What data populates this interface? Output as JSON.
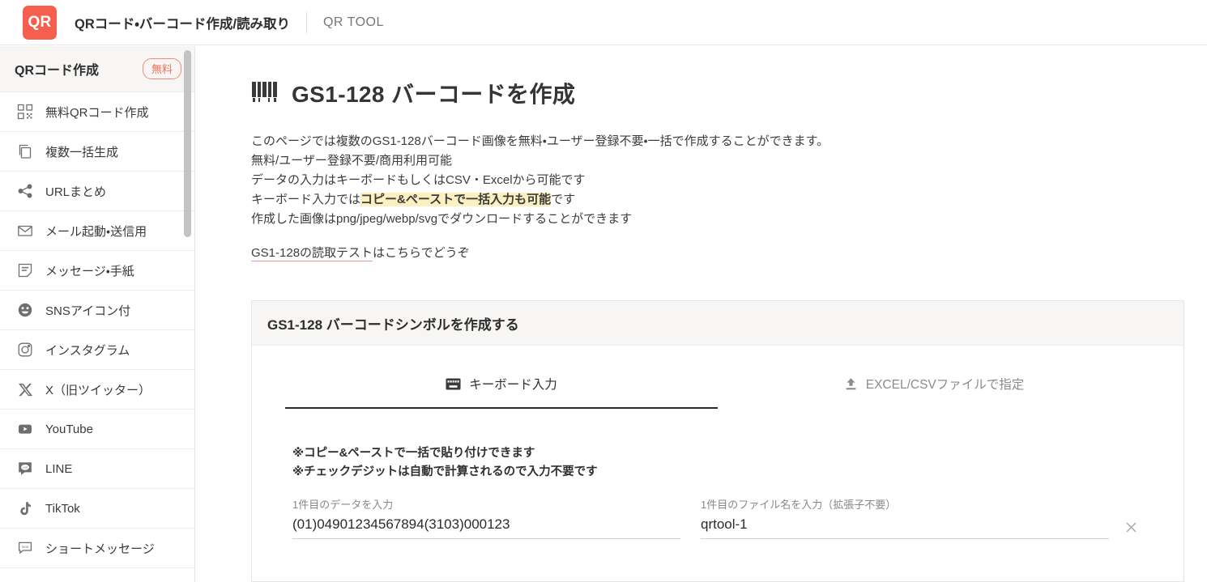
{
  "header": {
    "logo_text": "QR",
    "logo_color": "#f4604d",
    "title": "QRコード・バーコード作成/読み取り",
    "sub_title": "QR TOOL"
  },
  "sidebar": {
    "section_title": "QRコード作成",
    "badge": "無料",
    "badge_color": "#f0705c",
    "items": [
      {
        "label": "無料QRコード作成",
        "icon": "qr-grid-icon"
      },
      {
        "label": "複数一括生成",
        "icon": "copy-icon"
      },
      {
        "label": "URLまとめ",
        "icon": "share-icon"
      },
      {
        "label": "メール起動・送信用",
        "icon": "mail-icon"
      },
      {
        "label": "メッセージ・手紙",
        "icon": "note-icon"
      },
      {
        "label": "SNSアイコン付",
        "icon": "smiley-icon"
      },
      {
        "label": "インスタグラム",
        "icon": "instagram-icon"
      },
      {
        "label": "X（旧ツイッター）",
        "icon": "x-twitter-icon"
      },
      {
        "label": "YouTube",
        "icon": "youtube-icon"
      },
      {
        "label": "LINE",
        "icon": "line-icon"
      },
      {
        "label": "TikTok",
        "icon": "tiktok-icon"
      },
      {
        "label": "ショートメッセージ",
        "icon": "sms-icon"
      }
    ]
  },
  "main": {
    "page_title": "GS1-128 バーコードを作成",
    "page_title_icon": "barcode-icon",
    "description": [
      "このページでは複数のGS1-128バーコード画像を無料・ユーザー登録不要・一括で作成することができます。",
      "無料/ユーザー登録不要/商用利用可能",
      "データの入力はキーボードもしくはCSV・Excelから可能です"
    ],
    "highlight_line": {
      "prefix": "キーボード入力では",
      "highlight": "コピー&ペーストで一括入力も可能",
      "suffix": "です"
    },
    "description_tail": "作成した画像はpng/jpeg/webp/svgでダウンロードすることができます",
    "link_line": {
      "link_text": "GS1-128の読取テスト",
      "rest_text": "はこちらでどうぞ"
    }
  },
  "card": {
    "title": "GS1-128 バーコードシンボルを作成する",
    "tabs": [
      {
        "label": "キーボード入力",
        "icon": "keyboard-icon",
        "active": true
      },
      {
        "label": "EXCEL/CSVファイルで指定",
        "icon": "upload-icon",
        "active": false
      }
    ],
    "notes": [
      "※コピー&ペーストで一括で貼り付けできます",
      "※チェックデジットは自動で計算されるので入力不要です"
    ],
    "fields": [
      {
        "label": "1件目のデータを入力",
        "value": "(01)04901234567894(3103)000123"
      },
      {
        "label": "1件目のファイル名を入力（拡張子不要）",
        "value": "qrtool-1"
      }
    ],
    "clear_icon": "close-icon"
  }
}
